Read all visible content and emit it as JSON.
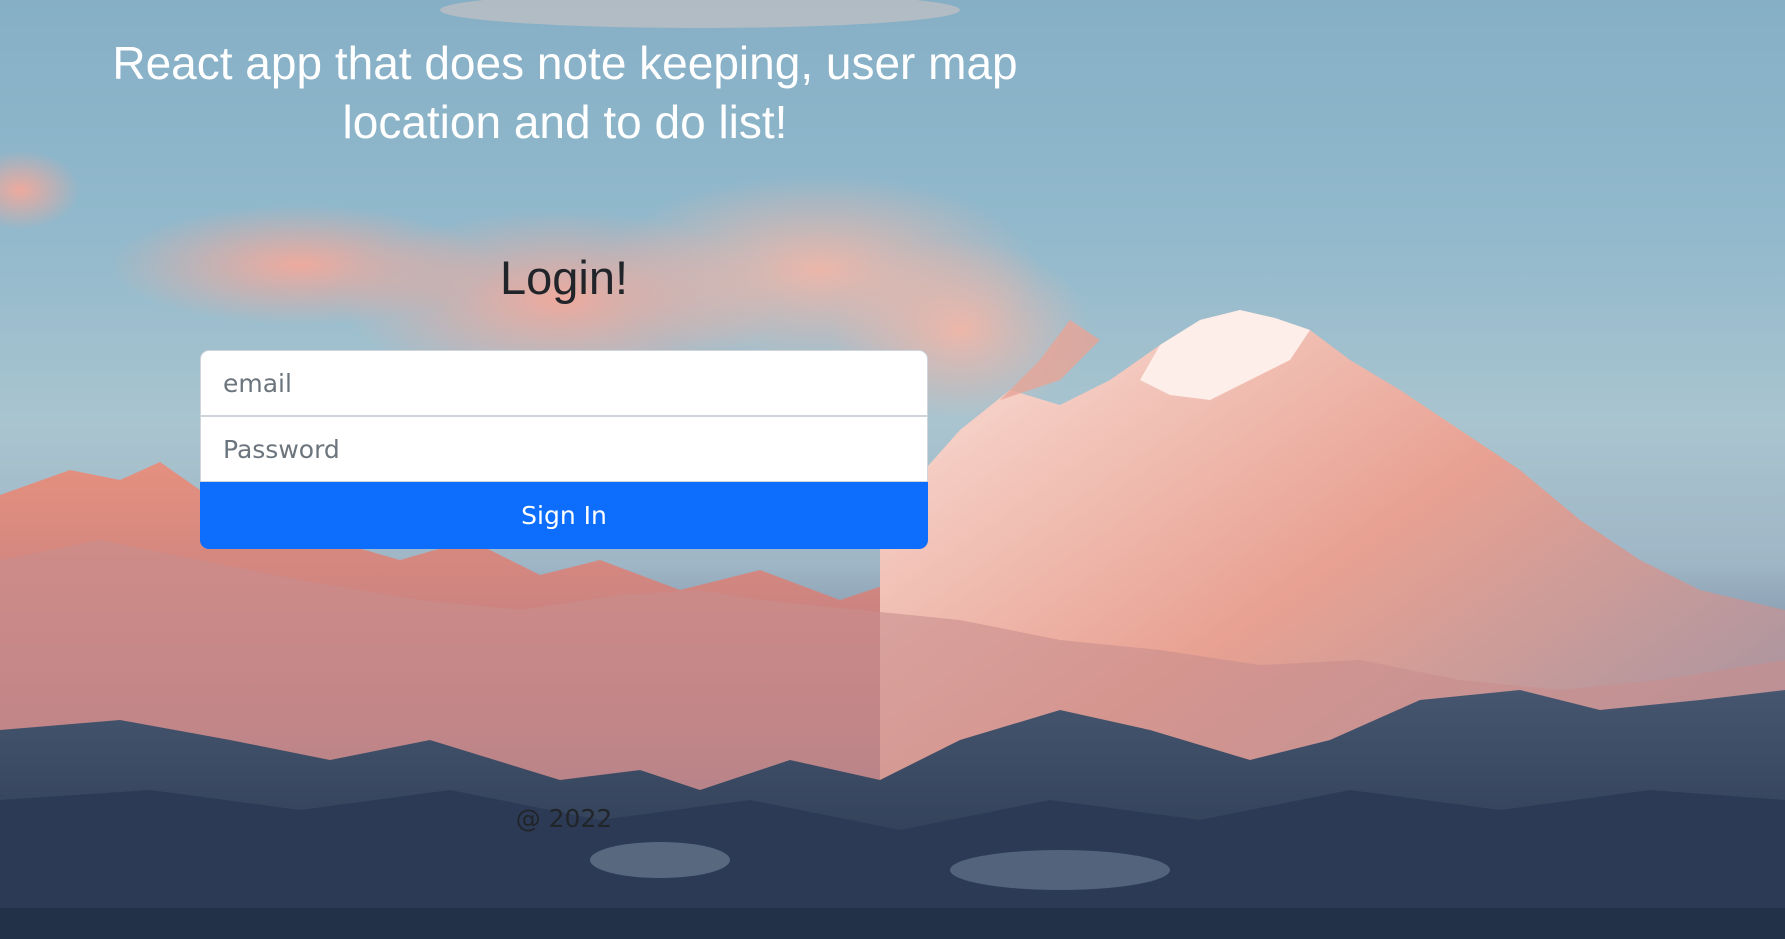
{
  "page": {
    "headline": "React app that does note keeping, user map location and to do list!",
    "background": "mountain-sunrise-photo"
  },
  "login": {
    "title": "Login!",
    "email_placeholder": "email",
    "email_value": "",
    "password_placeholder": "Password",
    "password_value": "",
    "submit_label": "Sign In"
  },
  "footer": {
    "text": "@ 2022"
  },
  "colors": {
    "primary_button": "#0d6efd",
    "heading_text": "#212529",
    "headline_text": "#ffffff"
  }
}
